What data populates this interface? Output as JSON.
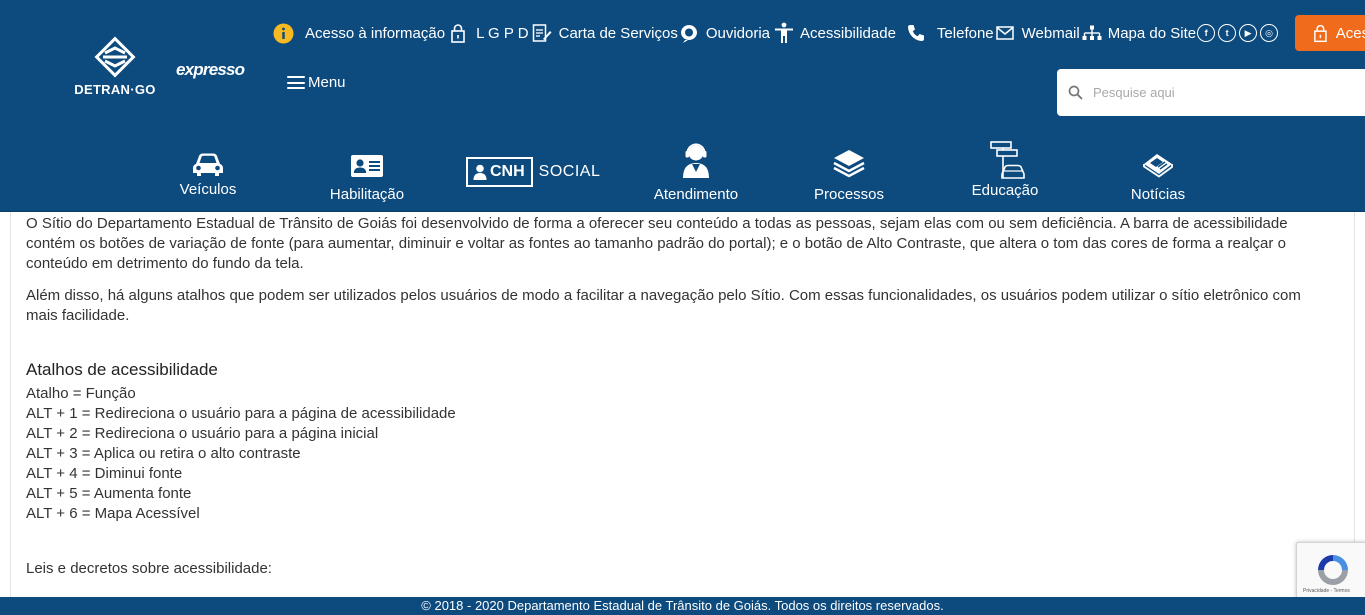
{
  "header": {
    "logo_text": "DETRAN·GO",
    "logo2_text": "expresso",
    "menu_label": "Menu",
    "search_placeholder": "Pesquise aqui",
    "acesso_label": "Acesso",
    "top_links": [
      {
        "label": "Acesso à informação",
        "icon": "info-icon"
      },
      {
        "label": "L G P D",
        "icon": "lock-icon"
      },
      {
        "label": "Carta de Serviços",
        "icon": "document-edit-icon"
      },
      {
        "label": "Ouvidoria",
        "icon": "speech-bubble-icon"
      },
      {
        "label": "Acessibilidade",
        "icon": "accessibility-icon"
      },
      {
        "label": "Telefone",
        "icon": "phone-icon"
      },
      {
        "label": "Webmail",
        "icon": "mail-icon"
      },
      {
        "label": "Mapa do Site",
        "icon": "sitemap-icon"
      }
    ],
    "social": [
      "f",
      "t",
      "▶",
      "◎"
    ],
    "categories": [
      {
        "label": "Veículos",
        "icon": "car-icon"
      },
      {
        "label": "Habilitação",
        "icon": "id-card-icon"
      },
      {
        "label": "Atendimento",
        "icon": "agent-icon"
      },
      {
        "label": "Processos",
        "icon": "stack-icon"
      },
      {
        "label": "Educação",
        "icon": "traffic-sign-icon"
      },
      {
        "label": "Notícias",
        "icon": "newspaper-icon"
      }
    ],
    "cnh_social": {
      "cnh": "CNH",
      "social": "SOCIAL"
    }
  },
  "content": {
    "paragraphs": [
      "O Sítio do Departamento Estadual de Trânsito de Goiás foi desenvolvido de forma a oferecer seu conteúdo a todas as pessoas, sejam elas com ou sem deficiência. A barra de acessibilidade contém os botões de variação de fonte (para aumentar, diminuir e voltar as fontes ao tamanho padrão do portal); e o botão de Alto Contraste, que altera o tom das cores de forma a realçar o conteúdo em detrimento do fundo da tela.",
      "Além disso, há alguns atalhos que podem ser utilizados pelos usuários de modo a facilitar a navegação pelo Sítio. Com essas funcionalidades, os usuários podem utilizar o sítio eletrônico com mais facilidade."
    ],
    "shortcuts_heading": "Atalhos de acessibilidade",
    "shortcuts": [
      "Atalho = Função",
      "ALT + 1 = Redireciona o usuário para a página de acessibilidade",
      "ALT + 2 = Redireciona o usuário para a página inicial",
      "ALT + 3 = Aplica ou retira o alto contraste",
      "ALT + 4 = Diminui fonte",
      "ALT + 5 = Aumenta fonte",
      "ALT + 6 = Mapa Acessível"
    ],
    "laws_label": "Leis e decretos sobre acessibilidade:"
  },
  "footer": {
    "copyright": "© 2018 - 2020 Departamento Estadual de Trânsito de Goiás. Todos os direitos reservados."
  },
  "recaptcha": {
    "text": "Privacidade - Termos"
  },
  "colors": {
    "header_bg": "#0d4a7e",
    "accent": "#f06b1b",
    "info_icon": "#f5b921"
  }
}
